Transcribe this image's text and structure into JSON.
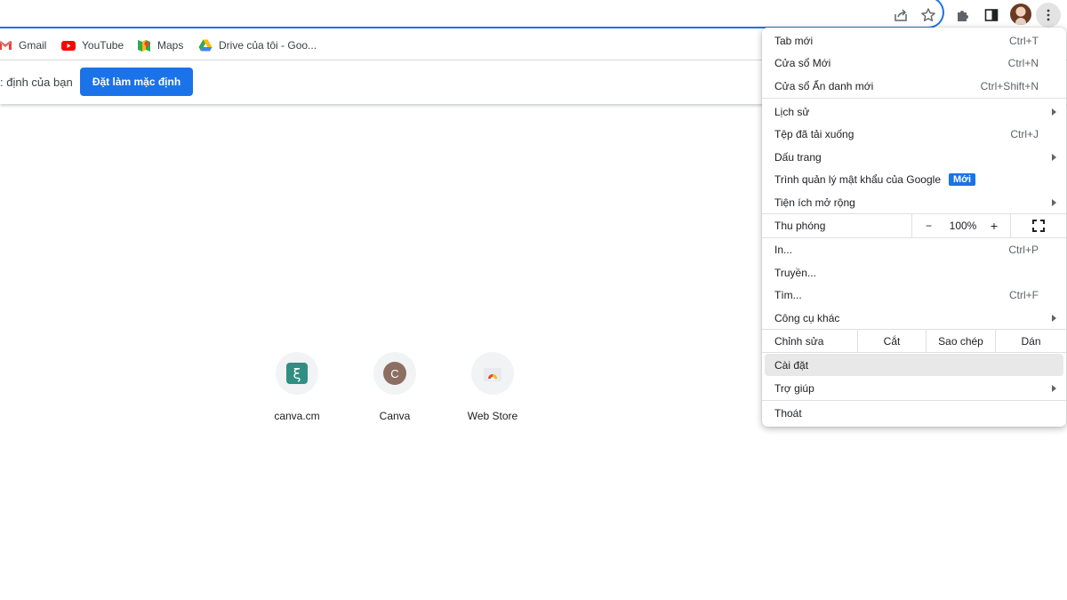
{
  "toolbar": {
    "share_icon": "share-icon",
    "bookmark_star_icon": "star-icon",
    "extensions_icon": "puzzle-icon",
    "side_panel_icon": "side-panel-icon",
    "profile_icon": "avatar",
    "menu_icon": "kebab-icon"
  },
  "bookmarks": [
    {
      "label": "Gmail",
      "icon": "gmail-icon"
    },
    {
      "label": "YouTube",
      "icon": "youtube-icon"
    },
    {
      "label": "Maps",
      "icon": "maps-icon"
    },
    {
      "label": "Drive của tôi - Goo...",
      "icon": "drive-icon"
    }
  ],
  "infobar": {
    "text": ": định của bạn",
    "button": "Đặt làm mặc định"
  },
  "shortcuts": [
    {
      "label": "canva.cm"
    },
    {
      "label": "Canva",
      "letter": "C"
    },
    {
      "label": "Web Store"
    }
  ],
  "menu": {
    "new_tab": {
      "label": "Tab mới",
      "shortcut": "Ctrl+T"
    },
    "new_window": {
      "label": "Cửa sổ Mới",
      "shortcut": "Ctrl+N"
    },
    "incognito": {
      "label": "Cửa sổ Ẩn danh mới",
      "shortcut": "Ctrl+Shift+N"
    },
    "history": {
      "label": "Lịch sử"
    },
    "downloads": {
      "label": "Tệp đã tải xuống",
      "shortcut": "Ctrl+J"
    },
    "bookmarks": {
      "label": "Dấu trang"
    },
    "password_manager": {
      "label": "Trình quản lý mật khẩu của Google",
      "badge": "Mới"
    },
    "extensions": {
      "label": "Tiện ích mở rộng"
    },
    "zoom": {
      "label": "Thu phóng",
      "minus": "−",
      "value": "100%",
      "plus": "+"
    },
    "print": {
      "label": "In...",
      "shortcut": "Ctrl+P"
    },
    "cast": {
      "label": "Truyền..."
    },
    "find": {
      "label": "Tìm...",
      "shortcut": "Ctrl+F"
    },
    "more_tools": {
      "label": "Công cụ khác"
    },
    "edit": {
      "label": "Chỉnh sửa",
      "cut": "Cắt",
      "copy": "Sao chép",
      "paste": "Dán"
    },
    "settings": {
      "label": "Cài đặt"
    },
    "help": {
      "label": "Trợ giúp"
    },
    "exit": {
      "label": "Thoát"
    }
  }
}
